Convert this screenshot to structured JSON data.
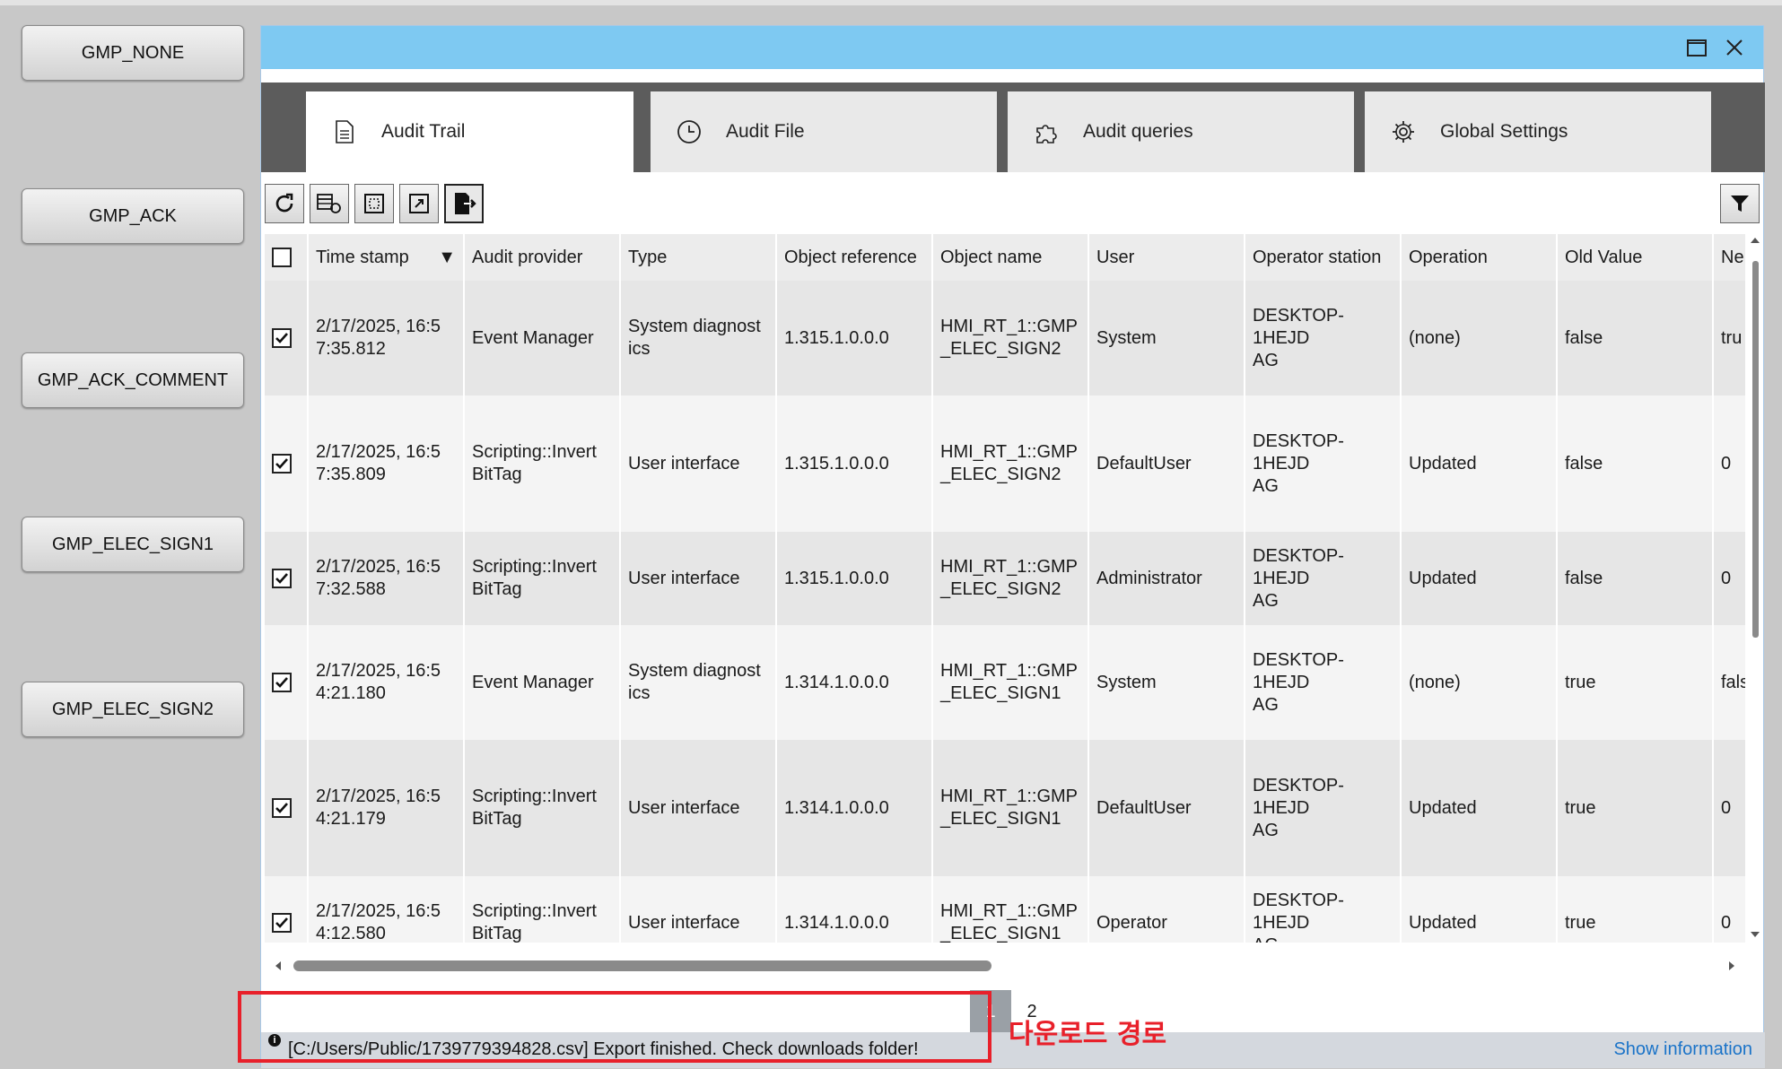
{
  "side_buttons": [
    "GMP_NONE",
    "GMP_ACK",
    "GMP_ACK_COMMENT",
    "GMP_ELEC_SIGN1",
    "GMP_ELEC_SIGN2"
  ],
  "tabs": [
    {
      "label": "Audit Trail",
      "icon": "document-icon",
      "active": true
    },
    {
      "label": "Audit File",
      "icon": "clock-icon",
      "active": false
    },
    {
      "label": "Audit queries",
      "icon": "puzzle-icon",
      "active": false
    },
    {
      "label": "Global Settings",
      "icon": "gear-icon",
      "active": false
    }
  ],
  "toolbar": {
    "icons": [
      "refresh-icon",
      "table-refresh-icon",
      "select-all-icon",
      "export-view-icon",
      "export-file-icon"
    ]
  },
  "table": {
    "sort_indicator": "▼",
    "columns": [
      "Time stamp",
      "Audit provider",
      "Type",
      "Object reference",
      "Object name",
      "User",
      "Operator station",
      "Operation",
      "Old Value",
      "Ne"
    ],
    "rows": [
      {
        "checked": true,
        "cells": [
          "2/17/2025, 16:5\n7:35.812",
          "Event Manager",
          "System diagnost\nics",
          "1.315.1.0.0.0",
          "HMI_RT_1::GMP\n_ELEC_SIGN2",
          "System",
          "DESKTOP-1HEJD\nAG",
          "(none)",
          "false",
          "tru"
        ]
      },
      {
        "checked": true,
        "cells": [
          "2/17/2025, 16:5\n7:35.809",
          "Scripting::Invert\nBitTag",
          "User interface",
          "1.315.1.0.0.0",
          "HMI_RT_1::GMP\n_ELEC_SIGN2",
          "DefaultUser",
          "DESKTOP-1HEJD\nAG",
          "Updated",
          "false",
          "0"
        ]
      },
      {
        "checked": true,
        "cells": [
          "2/17/2025, 16:5\n7:32.588",
          "Scripting::Invert\nBitTag",
          "User interface",
          "1.315.1.0.0.0",
          "HMI_RT_1::GMP\n_ELEC_SIGN2",
          "Administrator",
          "DESKTOP-1HEJD\nAG",
          "Updated",
          "false",
          "0"
        ]
      },
      {
        "checked": true,
        "cells": [
          "2/17/2025, 16:5\n4:21.180",
          "Event Manager",
          "System diagnost\nics",
          "1.314.1.0.0.0",
          "HMI_RT_1::GMP\n_ELEC_SIGN1",
          "System",
          "DESKTOP-1HEJD\nAG",
          "(none)",
          "true",
          "fals"
        ]
      },
      {
        "checked": true,
        "cells": [
          "2/17/2025, 16:5\n4:21.179",
          "Scripting::Invert\nBitTag",
          "User interface",
          "1.314.1.0.0.0",
          "HMI_RT_1::GMP\n_ELEC_SIGN1",
          "DefaultUser",
          "DESKTOP-1HEJD\nAG",
          "Updated",
          "true",
          "0"
        ]
      },
      {
        "checked": true,
        "cells": [
          "2/17/2025, 16:5\n4:12.580",
          "Scripting::Invert\nBitTag",
          "User interface",
          "1.314.1.0.0.0",
          "HMI_RT_1::GMP\n_ELEC_SIGN1",
          "Operator",
          "DESKTOP-1HEJD\nAG",
          "Updated",
          "true",
          "0"
        ]
      }
    ]
  },
  "pager": {
    "pages": [
      "1",
      "2"
    ],
    "current": "1"
  },
  "status": {
    "message": "[C:/Users/Public/1739779394828.csv] Export finished. Check downloads folder!",
    "show_info": "Show information"
  },
  "annotation": {
    "text": "다운로드 경로",
    "color": "#e8202a"
  },
  "colors": {
    "titlebar": "#7ec9f2",
    "tabstrip": "#5c5c5c",
    "link": "#1a73c8"
  }
}
